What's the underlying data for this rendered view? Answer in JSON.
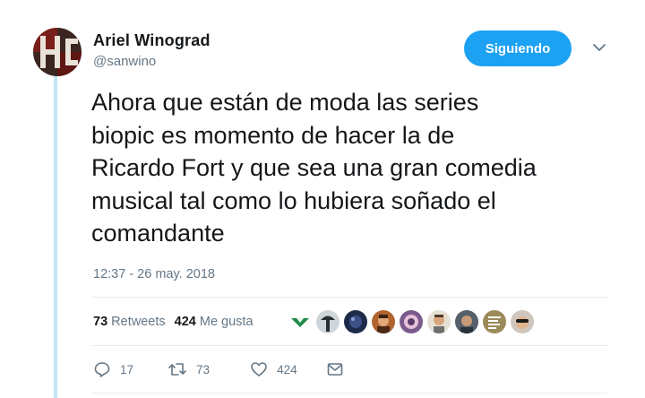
{
  "author": {
    "display_name": "Ariel Winograd",
    "handle": "@sanwino"
  },
  "follow_button": {
    "label": "Siguiendo"
  },
  "tweet": {
    "lines": [
      "Ahora que están de moda las series",
      "biopic es momento de hacer la de",
      "Ricardo Fort y que sea una gran comedia",
      "musical tal como lo hubiera soñado el",
      "comandante"
    ],
    "timestamp": "12:37 - 26 may. 2018"
  },
  "stats": {
    "retweets_count": "73",
    "retweets_label": "Retweets",
    "likes_count": "424",
    "likes_label": "Me gusta"
  },
  "actions": {
    "reply_count": "17",
    "retweet_count": "73",
    "like_count": "424"
  },
  "icons": [
    "reply-icon",
    "retweet-icon",
    "heart-icon",
    "message-icon",
    "chevron-down-icon"
  ],
  "colors": {
    "accent": "#1da1f2",
    "text": "#14171a",
    "secondary": "#657786",
    "divider": "#e6ecf0",
    "thread": "#c4e4f7"
  }
}
